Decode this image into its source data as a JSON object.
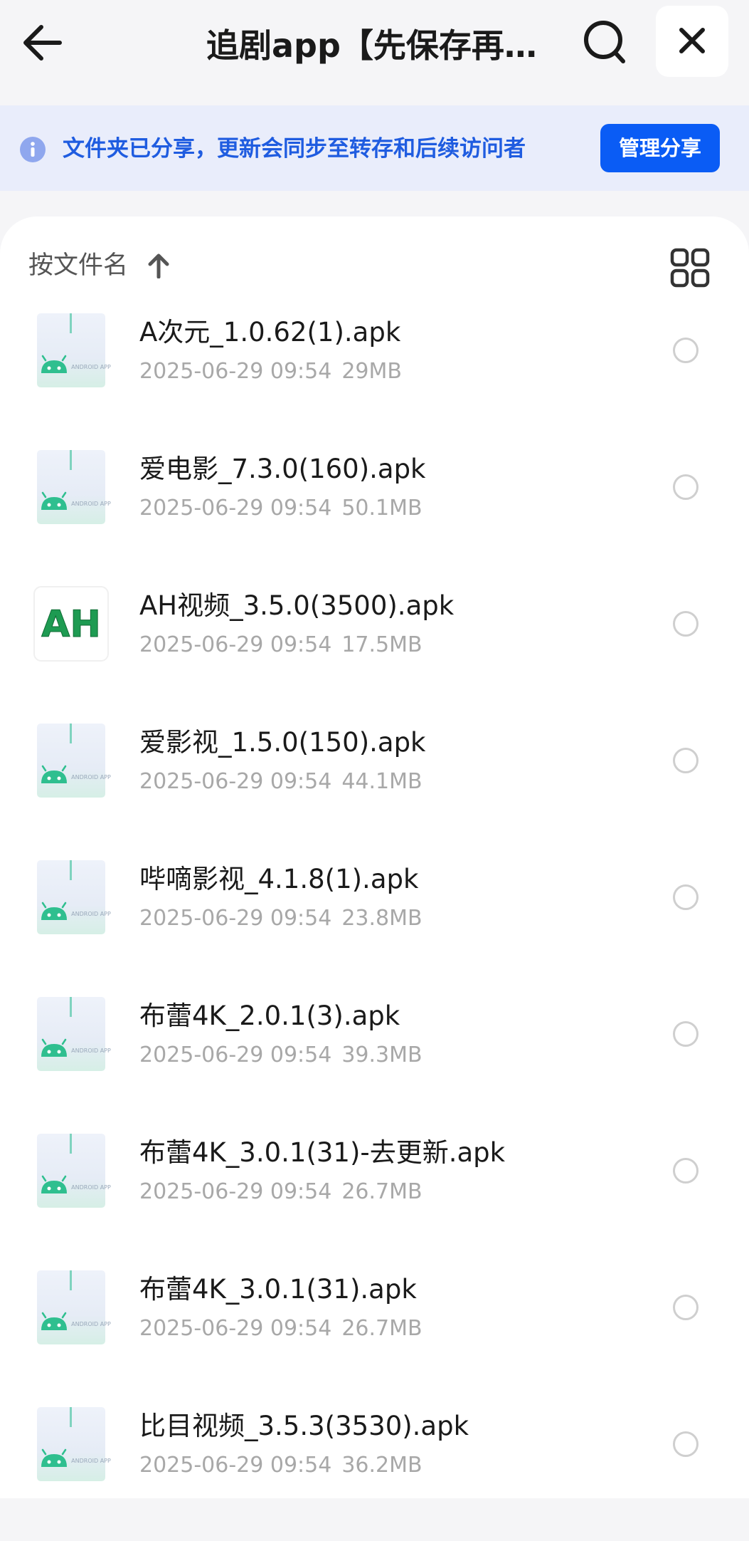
{
  "header": {
    "title": "追剧app【先保存再…",
    "back_icon": "arrow-left-icon",
    "search_icon": "search-icon",
    "close_icon": "close-icon"
  },
  "banner": {
    "info_icon": "info-icon",
    "text": "文件夹已分享，更新会同步至转存和后续访问者",
    "manage_label": "管理分享",
    "accent": "#0a5cf5"
  },
  "sort": {
    "label": "按文件名",
    "arrow_icon": "arrow-up-icon",
    "view_icon": "grid-view-icon"
  },
  "files": [
    {
      "name": "A次元_1.0.62(1).apk",
      "date": "2025-06-29 09:54",
      "size": "29MB",
      "icon": "android-app-icon"
    },
    {
      "name": "爱电影_7.3.0(160).apk",
      "date": "2025-06-29 09:54",
      "size": "50.1MB",
      "icon": "android-app-icon"
    },
    {
      "name": "AH视频_3.5.0(3500).apk",
      "date": "2025-06-29 09:54",
      "size": "17.5MB",
      "icon": "ah-app-icon",
      "icon_text": "AH"
    },
    {
      "name": "爱影视_1.5.0(150).apk",
      "date": "2025-06-29 09:54",
      "size": "44.1MB",
      "icon": "android-app-icon"
    },
    {
      "name": "哔嘀影视_4.1.8(1).apk",
      "date": "2025-06-29 09:54",
      "size": "23.8MB",
      "icon": "android-app-icon"
    },
    {
      "name": "布蕾4K_2.0.1(3).apk",
      "date": "2025-06-29 09:54",
      "size": "39.3MB",
      "icon": "android-app-icon"
    },
    {
      "name": "布蕾4K_3.0.1(31)-去更新.apk",
      "date": "2025-06-29 09:54",
      "size": "26.7MB",
      "icon": "android-app-icon"
    },
    {
      "name": "布蕾4K_3.0.1(31).apk",
      "date": "2025-06-29 09:54",
      "size": "26.7MB",
      "icon": "android-app-icon"
    },
    {
      "name": "比目视频_3.5.3(3530).apk",
      "date": "2025-06-29 09:54",
      "size": "36.2MB",
      "icon": "android-app-icon"
    }
  ],
  "thumb_label": "ANDROID APP"
}
